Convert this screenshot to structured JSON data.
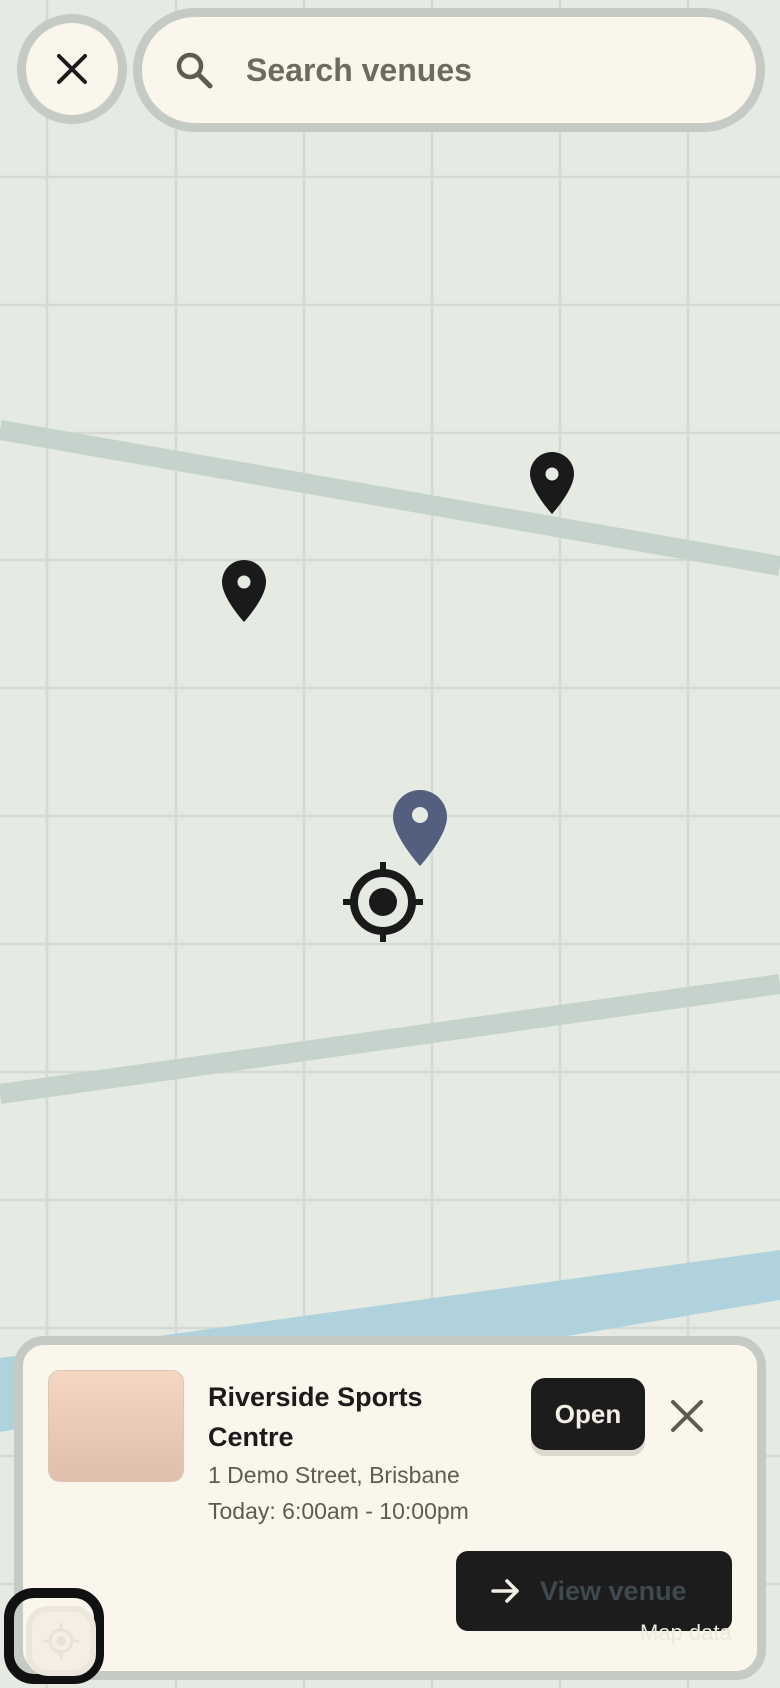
{
  "search": {
    "placeholder": "Search venues"
  },
  "icons": {
    "close": "close-icon",
    "search": "search-icon",
    "pin": "map-pin-icon",
    "selected_pin": "selected-map-pin-icon",
    "current_location": "crosshair-icon",
    "arrow": "arrow-right-icon",
    "locate": "locate-icon"
  },
  "venue_card": {
    "name": "Riverside Sports Centre",
    "address": "1 Demo Street, Brisbane",
    "hours": "Today: 6:00am - 10:00pm",
    "status": "Open",
    "view_button_label": "View venue"
  },
  "map": {
    "attribution": "Map data"
  },
  "colors": {
    "map_background": "#e5ebe3",
    "grid_line": "#d4dad3",
    "road": "#c5d3cc",
    "water": "#afd2dc",
    "pin": "#1a1a1a",
    "selected_pin": "#545f80",
    "card_background": "#faf6ec",
    "button_dark": "#1c1c1c"
  }
}
